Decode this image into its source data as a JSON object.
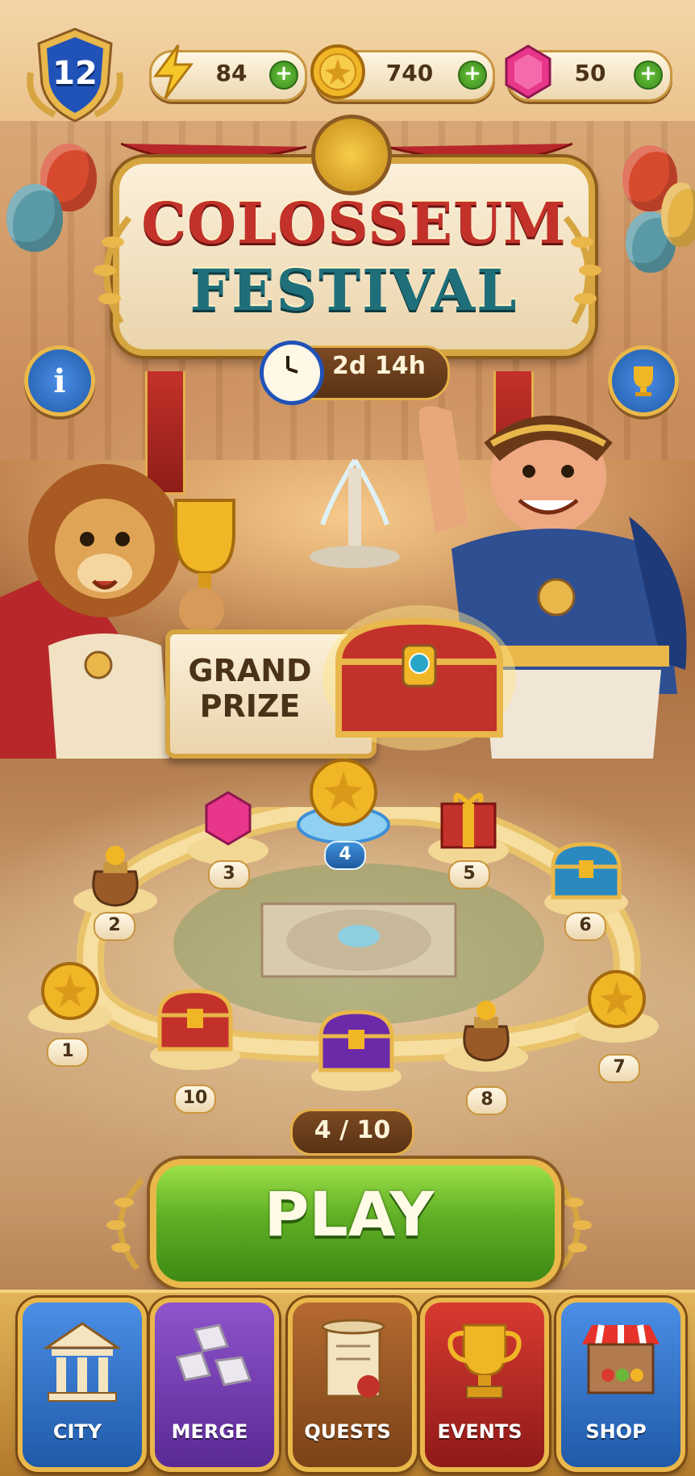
{
  "hud": {
    "level": "12",
    "energy": {
      "value": "84",
      "icon": "lightning-icon"
    },
    "coins": {
      "value": "740",
      "icon": "coin-icon"
    },
    "gems": {
      "value": "50",
      "icon": "gem-icon"
    },
    "add_symbol": "+"
  },
  "event": {
    "title_line1": "COLOSSEUM",
    "title_line2": "FESTIVAL",
    "timer": "2d 14h"
  },
  "grand_prize": {
    "label_line1": "GRAND",
    "label_line2": "PRIZE"
  },
  "track": {
    "nodes": [
      {
        "number": "1",
        "reward": "coin-icon"
      },
      {
        "number": "2",
        "reward": "coin-bag-icon"
      },
      {
        "number": "3",
        "reward": "gem-icon"
      },
      {
        "number": "4",
        "reward": "coin-icon",
        "current": true
      },
      {
        "number": "5",
        "reward": "gift-box-icon"
      },
      {
        "number": "6",
        "reward": "blue-chest-icon"
      },
      {
        "number": "7",
        "reward": "coin-icon"
      },
      {
        "number": "8",
        "reward": "coin-bag-icon"
      },
      {
        "number": "10",
        "reward": "red-chest-icon"
      }
    ],
    "progress": "4 / 10",
    "progress_current": 4,
    "progress_total": 10
  },
  "play_button": "PLAY",
  "nav": [
    {
      "label": "CITY",
      "icon": "temple-icon",
      "color": "#2d6fc4"
    },
    {
      "label": "MERGE",
      "icon": "blocks-icon",
      "color": "#6d3aa8"
    },
    {
      "label": "QUESTS",
      "icon": "scroll-icon",
      "color": "#9c5424"
    },
    {
      "label": "EVENTS",
      "icon": "trophy-icon",
      "color": "#b8282a"
    },
    {
      "label": "SHOP",
      "icon": "shop-stall-icon",
      "color": "#2d6fc4"
    }
  ],
  "colors": {
    "accent_gold": "#e9b74a",
    "play_green": "#5fae24",
    "title_red": "#c3322a",
    "title_teal": "#1f6f7a"
  }
}
